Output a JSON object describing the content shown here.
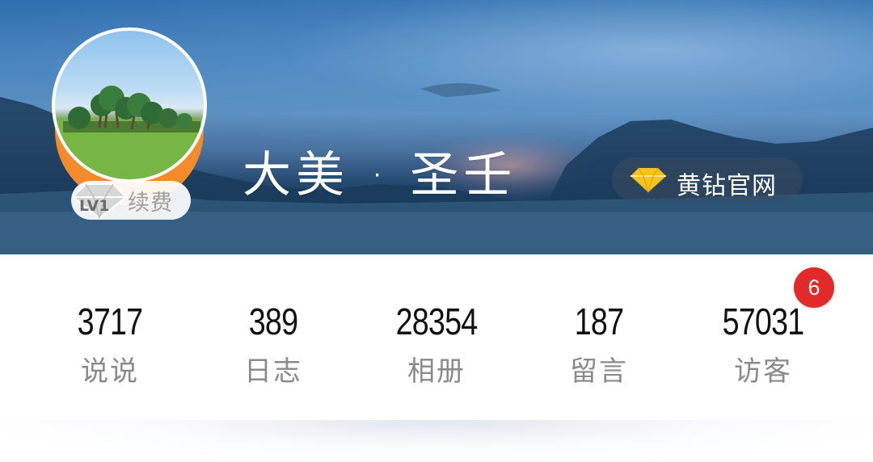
{
  "profile": {
    "name": "大美 · 圣壬",
    "level": "LV1",
    "renew_label": "续费",
    "vip_label": "黄钻官网"
  },
  "stats": [
    {
      "value": "3717",
      "label": "说说"
    },
    {
      "value": "389",
      "label": "日志"
    },
    {
      "value": "28354",
      "label": "相册"
    },
    {
      "value": "187",
      "label": "留言"
    },
    {
      "value": "57031",
      "label": "访客"
    }
  ],
  "visitor_badge": "6",
  "colors": {
    "accent_orange": "#f38a2b",
    "badge_red": "#e32a2a",
    "vip_gold": "#f7c21a"
  },
  "icons": {
    "vip": "diamond-icon",
    "level": "level-diamond-icon"
  }
}
